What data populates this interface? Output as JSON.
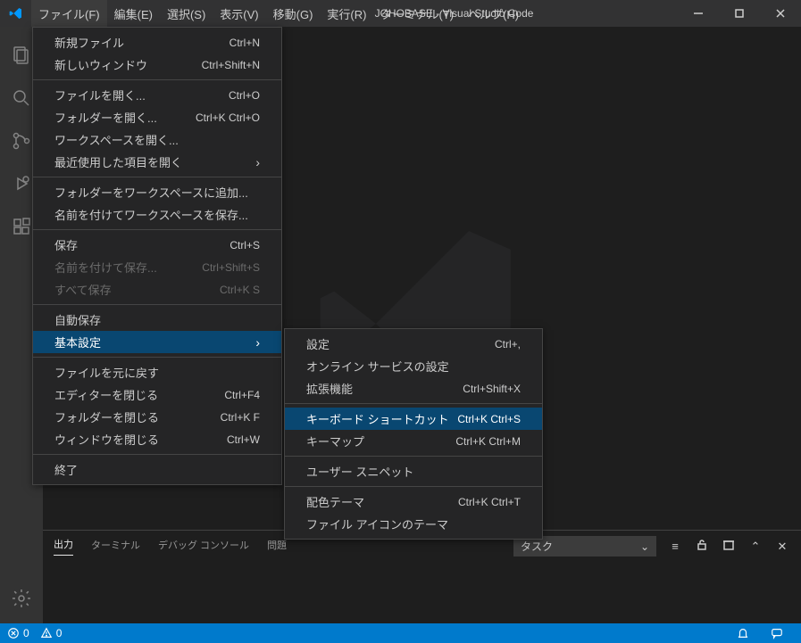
{
  "title": "JOHOBASE - Visual Studio Code",
  "menubar": [
    "ファイル(F)",
    "編集(E)",
    "選択(S)",
    "表示(V)",
    "移動(G)",
    "実行(R)",
    "ターミナル(T)",
    "ヘルプ(H)"
  ],
  "fileMenu": [
    {
      "type": "item",
      "label": "新規ファイル",
      "shortcut": "Ctrl+N"
    },
    {
      "type": "item",
      "label": "新しいウィンドウ",
      "shortcut": "Ctrl+Shift+N"
    },
    {
      "type": "sep"
    },
    {
      "type": "item",
      "label": "ファイルを開く...",
      "shortcut": "Ctrl+O"
    },
    {
      "type": "item",
      "label": "フォルダーを開く...",
      "shortcut": "Ctrl+K Ctrl+O"
    },
    {
      "type": "item",
      "label": "ワークスペースを開く..."
    },
    {
      "type": "item",
      "label": "最近使用した項目を開く",
      "submenu": true
    },
    {
      "type": "sep"
    },
    {
      "type": "item",
      "label": "フォルダーをワークスペースに追加..."
    },
    {
      "type": "item",
      "label": "名前を付けてワークスペースを保存..."
    },
    {
      "type": "sep"
    },
    {
      "type": "item",
      "label": "保存",
      "shortcut": "Ctrl+S"
    },
    {
      "type": "item",
      "label": "名前を付けて保存...",
      "shortcut": "Ctrl+Shift+S",
      "disabled": true
    },
    {
      "type": "item",
      "label": "すべて保存",
      "shortcut": "Ctrl+K S",
      "disabled": true
    },
    {
      "type": "sep"
    },
    {
      "type": "item",
      "label": "自動保存"
    },
    {
      "type": "item",
      "label": "基本設定",
      "submenu": true,
      "highlight": true
    },
    {
      "type": "sep"
    },
    {
      "type": "item",
      "label": "ファイルを元に戻す"
    },
    {
      "type": "item",
      "label": "エディターを閉じる",
      "shortcut": "Ctrl+F4"
    },
    {
      "type": "item",
      "label": "フォルダーを閉じる",
      "shortcut": "Ctrl+K F"
    },
    {
      "type": "item",
      "label": "ウィンドウを閉じる",
      "shortcut": "Ctrl+W"
    },
    {
      "type": "sep"
    },
    {
      "type": "item",
      "label": "終了"
    }
  ],
  "prefMenu": [
    {
      "type": "item",
      "label": "設定",
      "shortcut": "Ctrl+,"
    },
    {
      "type": "item",
      "label": "オンライン サービスの設定"
    },
    {
      "type": "item",
      "label": "拡張機能",
      "shortcut": "Ctrl+Shift+X"
    },
    {
      "type": "sep"
    },
    {
      "type": "item",
      "label": "キーボード ショートカット",
      "shortcut": "Ctrl+K Ctrl+S",
      "highlight": true
    },
    {
      "type": "item",
      "label": "キーマップ",
      "shortcut": "Ctrl+K Ctrl+M"
    },
    {
      "type": "sep"
    },
    {
      "type": "item",
      "label": "ユーザー スニペット"
    },
    {
      "type": "sep"
    },
    {
      "type": "item",
      "label": "配色テーマ",
      "shortcut": "Ctrl+K Ctrl+T"
    },
    {
      "type": "item",
      "label": "ファイル アイコンのテーマ"
    }
  ],
  "panel": {
    "tabs": [
      "出力",
      "ターミナル",
      "デバッグ コンソール",
      "問題"
    ],
    "activeTab": 0,
    "selectLabel": "タスク"
  },
  "statusbar": {
    "errors": "0",
    "warnings": "0"
  }
}
